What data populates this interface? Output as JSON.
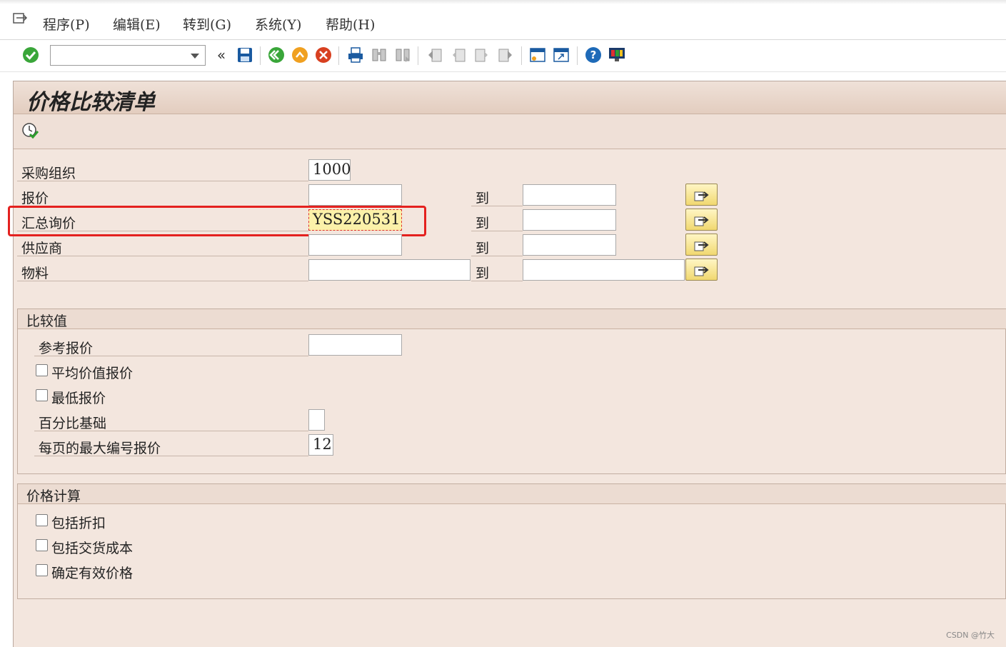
{
  "menu": {
    "items": [
      "程序(P)",
      "编辑(E)",
      "转到(G)",
      "系统(Y)",
      "帮助(H)"
    ]
  },
  "toolbar": {
    "command_field": "",
    "icons": [
      "enter-check-icon",
      "command-dropdown-icon",
      "collapse-icon",
      "save-icon",
      "back-icon",
      "exit-icon",
      "cancel-icon",
      "print-icon",
      "find-icon",
      "find-next-icon",
      "first-page-icon",
      "previous-page-icon",
      "next-page-icon",
      "last-page-icon",
      "create-session-icon",
      "shortcut-icon",
      "help-icon",
      "customize-layout-icon"
    ]
  },
  "page": {
    "title": "价格比较清单",
    "execute_icon": "execute-clock-icon"
  },
  "selection": {
    "to_label": "到",
    "rows": [
      {
        "label": "采购组织",
        "from": "1000",
        "to": null
      },
      {
        "label": "报价",
        "from": "",
        "to": ""
      },
      {
        "label": "汇总询价",
        "from": "YSS220531",
        "to": ""
      },
      {
        "label": "供应商",
        "from": "",
        "to": ""
      },
      {
        "label": "物料",
        "from": "",
        "to": ""
      }
    ]
  },
  "compare_values": {
    "title": "比较值",
    "ref_quote_label": "参考报价",
    "ref_quote_value": "",
    "avg_quote_label": "平均价值报价",
    "avg_quote_checked": false,
    "min_quote_label": "最低报价",
    "min_quote_checked": false,
    "percent_base_label": "百分比基础",
    "percent_base_value": "",
    "max_quotes_label": "每页的最大编号报价",
    "max_quotes_value": "12"
  },
  "price_calc": {
    "title": "价格计算",
    "include_discount_label": "包括折扣",
    "include_discount_checked": false,
    "include_delivery_label": "包括交货成本",
    "include_delivery_checked": false,
    "effective_price_label": "确定有效价格",
    "effective_price_checked": false
  },
  "colors": {
    "highlight_box": "#e4211f",
    "focused_field_bg": "#fbf1a9",
    "frame_bg": "#f3e6de"
  },
  "watermark": "CSDN @竹大"
}
